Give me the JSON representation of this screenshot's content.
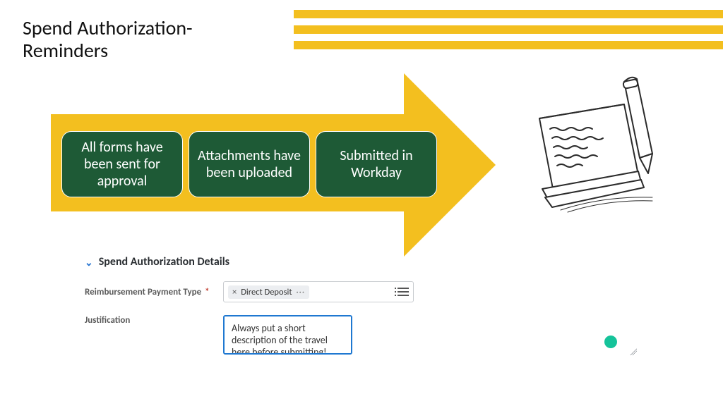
{
  "title": "Spend Authorization-\nReminders",
  "steps": [
    "All forms have been sent for approval",
    "Attachments have been uploaded",
    "Submitted in Workday"
  ],
  "details": {
    "heading": "Spend Authorization Details",
    "payment_type_label": "Reimbursement Payment Type",
    "payment_type_value": "Direct Deposit",
    "justification_label": "Justification",
    "justification_value": "Always put a short description of the travel here before submitting!"
  }
}
